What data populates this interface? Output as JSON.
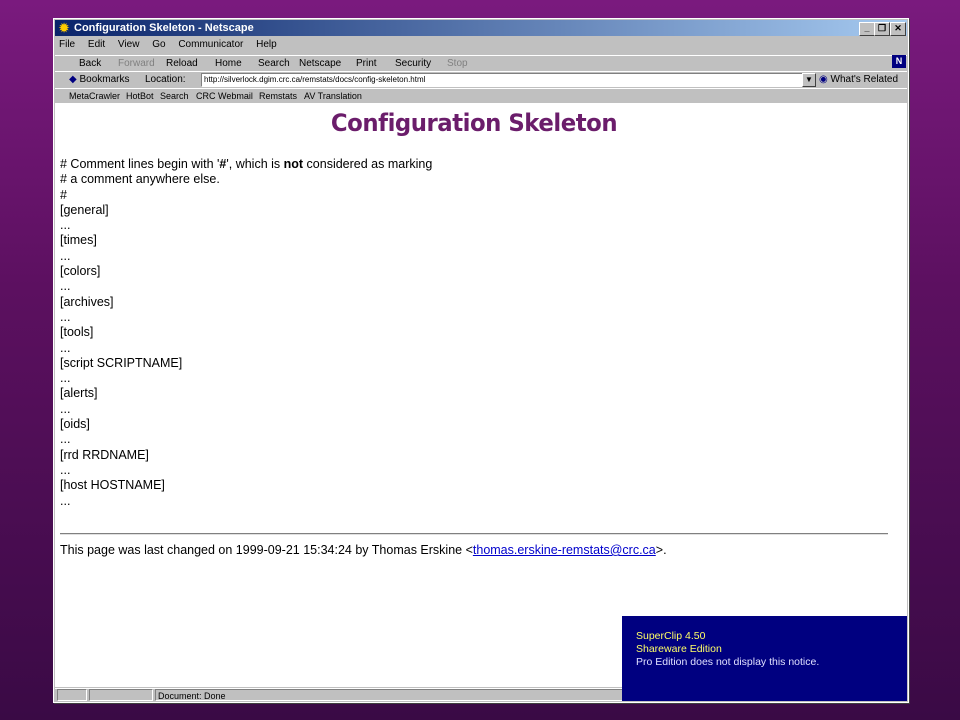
{
  "window": {
    "title": "Configuration Skeleton - Netscape",
    "controls": {
      "minimize": "_",
      "restore": "❐",
      "close": "✕"
    }
  },
  "menu": [
    "File",
    "Edit",
    "View",
    "Go",
    "Communicator",
    "Help"
  ],
  "nav": [
    {
      "label": "Back",
      "enabled": true
    },
    {
      "label": "Forward",
      "enabled": false
    },
    {
      "label": "Reload",
      "enabled": true
    },
    {
      "label": "Home",
      "enabled": true
    },
    {
      "label": "Search",
      "enabled": true
    },
    {
      "label": "Netscape",
      "enabled": true
    },
    {
      "label": "Print",
      "enabled": true
    },
    {
      "label": "Security",
      "enabled": true
    },
    {
      "label": "Stop",
      "enabled": false
    }
  ],
  "location": {
    "bookmarks_label": "Bookmarks",
    "location_label": "Location:",
    "url": "http://silverlock.dgim.crc.ca/remstats/docs/config-skeleton.html",
    "related_label": "What's Related"
  },
  "personal": [
    "MetaCrawler",
    "HotBot",
    "Search",
    "CRC Webmail",
    "Remstats",
    "AV Translation"
  ],
  "page": {
    "heading": "Configuration Skeleton",
    "comment_line1_a": "# Comment lines begin with '",
    "comment_line1_hash": "#",
    "comment_line1_b": "', which is ",
    "comment_line1_not": "not",
    "comment_line1_c": " considered as marking",
    "comment_line2": "# a comment anywhere else.",
    "lines": [
      "#",
      "[general]",
      "...",
      "[times]",
      "...",
      "[colors]",
      "...",
      "[archives]",
      "...",
      "[tools]",
      "...",
      "[script SCRIPTNAME]",
      "...",
      "[alerts]",
      "...",
      "[oids]",
      "...",
      "[rrd RRDNAME]",
      "...",
      "[host HOSTNAME]",
      "..."
    ],
    "footer_prefix": "This page was last changed on 1999-09-21 15:34:24 by Thomas Erskine <",
    "footer_email": "thomas.erskine-remstats@crc.ca",
    "footer_suffix": ">."
  },
  "status": {
    "text": "Document: Done"
  },
  "notice": {
    "line1": "SuperClip 4.50",
    "line2": "Shareware Edition",
    "line3": "Pro Edition does not display this notice."
  },
  "colors": {
    "heading": "#6b1d6b",
    "background_top": "#7a1a7e",
    "notice_bg": "#000080",
    "link": "#0000cc"
  }
}
